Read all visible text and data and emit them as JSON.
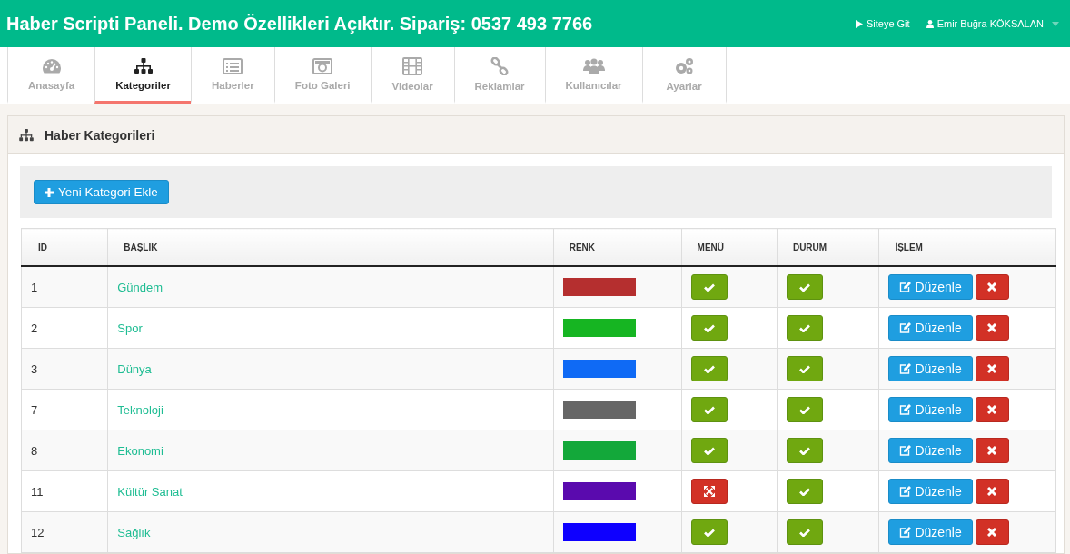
{
  "header": {
    "title": "Haber Scripti Paneli. Demo Özellikleri Açıktır. Sipariş: 0537 493 7766",
    "site_link": "Siteye Git",
    "user": "Emir Buğra KÖKSALAN"
  },
  "tabs": [
    {
      "label": "Anasayfa",
      "kind": "gauge",
      "selected": false
    },
    {
      "label": "Kategoriler",
      "kind": "sitemap",
      "selected": true
    },
    {
      "label": "Haberler",
      "kind": "list",
      "selected": false
    },
    {
      "label": "Foto Galeri",
      "kind": "camera",
      "selected": false
    },
    {
      "label": "Videolar",
      "kind": "film",
      "selected": false
    },
    {
      "label": "Reklamlar",
      "kind": "link",
      "selected": false
    },
    {
      "label": "Kullanıcılar",
      "kind": "users",
      "selected": false
    },
    {
      "label": "Ayarlar",
      "kind": "gears",
      "selected": false
    }
  ],
  "panel": {
    "title": "Haber Kategorileri",
    "add_button": "Yeni Kategori Ekle"
  },
  "table": {
    "columns": [
      "ID",
      "BAŞLIK",
      "RENK",
      "MENÜ",
      "DURUM",
      "İŞLEM"
    ],
    "rows": [
      {
        "id": "1",
        "title": "Gündem",
        "color": "#b52f2f",
        "menu": true,
        "status": true,
        "edit_label": "Düzenle"
      },
      {
        "id": "2",
        "title": "Spor",
        "color": "#16b522",
        "menu": true,
        "status": true,
        "edit_label": "Düzenle"
      },
      {
        "id": "3",
        "title": "Dünya",
        "color": "#0f6af5",
        "menu": true,
        "status": true,
        "edit_label": "Düzenle"
      },
      {
        "id": "7",
        "title": "Teknoloji",
        "color": "#666666",
        "menu": true,
        "status": true,
        "edit_label": "Düzenle"
      },
      {
        "id": "8",
        "title": "Ekonomi",
        "color": "#13a83a",
        "menu": true,
        "status": true,
        "edit_label": "Düzenle"
      },
      {
        "id": "11",
        "title": "Kültür Sanat",
        "color": "#5a0aae",
        "menu": false,
        "status": true,
        "edit_label": "Düzenle"
      },
      {
        "id": "12",
        "title": "Sağlık",
        "color": "#0e00ff",
        "menu": true,
        "status": true,
        "edit_label": "Düzenle"
      }
    ]
  }
}
